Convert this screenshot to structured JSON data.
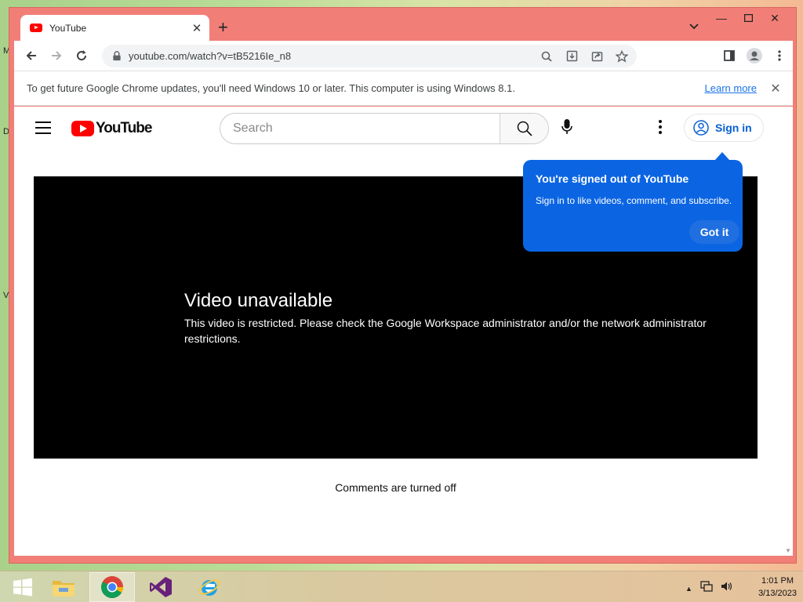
{
  "browser": {
    "tab_title": "YouTube",
    "url": "youtube.com/watch?v=tB5216Ie_n8"
  },
  "infobar": {
    "message": "To get future Google Chrome updates, you'll need Windows 10 or later. This computer is using Windows 8.1.",
    "link": "Learn more"
  },
  "youtube": {
    "logo_text": "YouTube",
    "search_placeholder": "Search",
    "sign_in_label": "Sign in",
    "tooltip": {
      "title": "You're signed out of YouTube",
      "body": "Sign in to like videos, comment, and subscribe.",
      "button": "Got it"
    },
    "player": {
      "title": "Video unavailable",
      "reason": "This video is restricted. Please check the Google Workspace administrator and/or the network administrator restrictions."
    },
    "comments_status": "Comments are turned off"
  },
  "desktop": {
    "edge_letters": [
      "M",
      "D",
      "V"
    ]
  },
  "taskbar": {
    "apps": [
      "windows-start-icon",
      "file-explorer-icon",
      "chrome-icon",
      "visual-studio-icon",
      "internet-explorer-icon"
    ],
    "time": "1:01 PM",
    "date": "3/13/2023"
  },
  "colors": {
    "titlebar": "#f17f77",
    "youtube_red": "#ff0000",
    "tooltip_blue": "#0b65e3",
    "link_blue": "#065fd4"
  }
}
